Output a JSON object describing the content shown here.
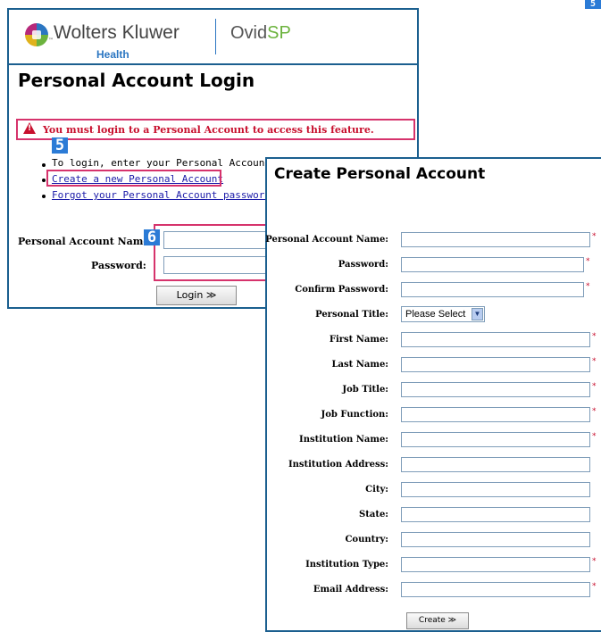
{
  "badges": {
    "step5": "5",
    "step6": "6",
    "corner": "5"
  },
  "login_window": {
    "brand": {
      "company": "Wolters Kluwer",
      "division": "Health",
      "product_prefix": "Ovid",
      "product_suffix": "SP",
      "tm": "™"
    },
    "title": "Personal Account Login",
    "alert": {
      "icon": "warning-icon",
      "mark": "!",
      "text": "You must login to a Personal Account to access this feature."
    },
    "instruction": "To login, enter your Personal Account Name and Password",
    "links": {
      "create": "Create a new Personal Account",
      "forgot": "Forgot your Personal Account password?"
    },
    "fields": {
      "account_name_label": "Personal Account Name:",
      "password_label": "Password:"
    },
    "login_button": "Login ≫"
  },
  "create_window": {
    "title": "Create Personal Account",
    "fields": [
      {
        "label": "Personal Account Name:",
        "required": true
      },
      {
        "label": "Password:",
        "required": true
      },
      {
        "label": "Confirm Password:",
        "required": true
      },
      {
        "label": "Personal Title:",
        "type": "select",
        "value": "Please Select"
      },
      {
        "label": "First Name:",
        "required": true
      },
      {
        "label": "Last Name:",
        "required": true
      },
      {
        "label": "Job Title:",
        "required": true
      },
      {
        "label": "Job Function:",
        "required": true
      },
      {
        "label": "Institution Name:",
        "required": true
      },
      {
        "label": "Institution Address:",
        "required": false
      },
      {
        "label": "City:",
        "required": false
      },
      {
        "label": "State:",
        "required": false
      },
      {
        "label": "Country:",
        "required": false
      },
      {
        "label": "Institution Type:",
        "required": true
      },
      {
        "label": "Email Address:",
        "required": true
      }
    ],
    "required_mark": "*",
    "create_button": "Create ≫"
  },
  "colors": {
    "frame": "#1b5f8f",
    "highlight": "#d6336c",
    "alert_text": "#c8102e",
    "badge": "#2b7bd6",
    "link": "#1a1aa8"
  }
}
